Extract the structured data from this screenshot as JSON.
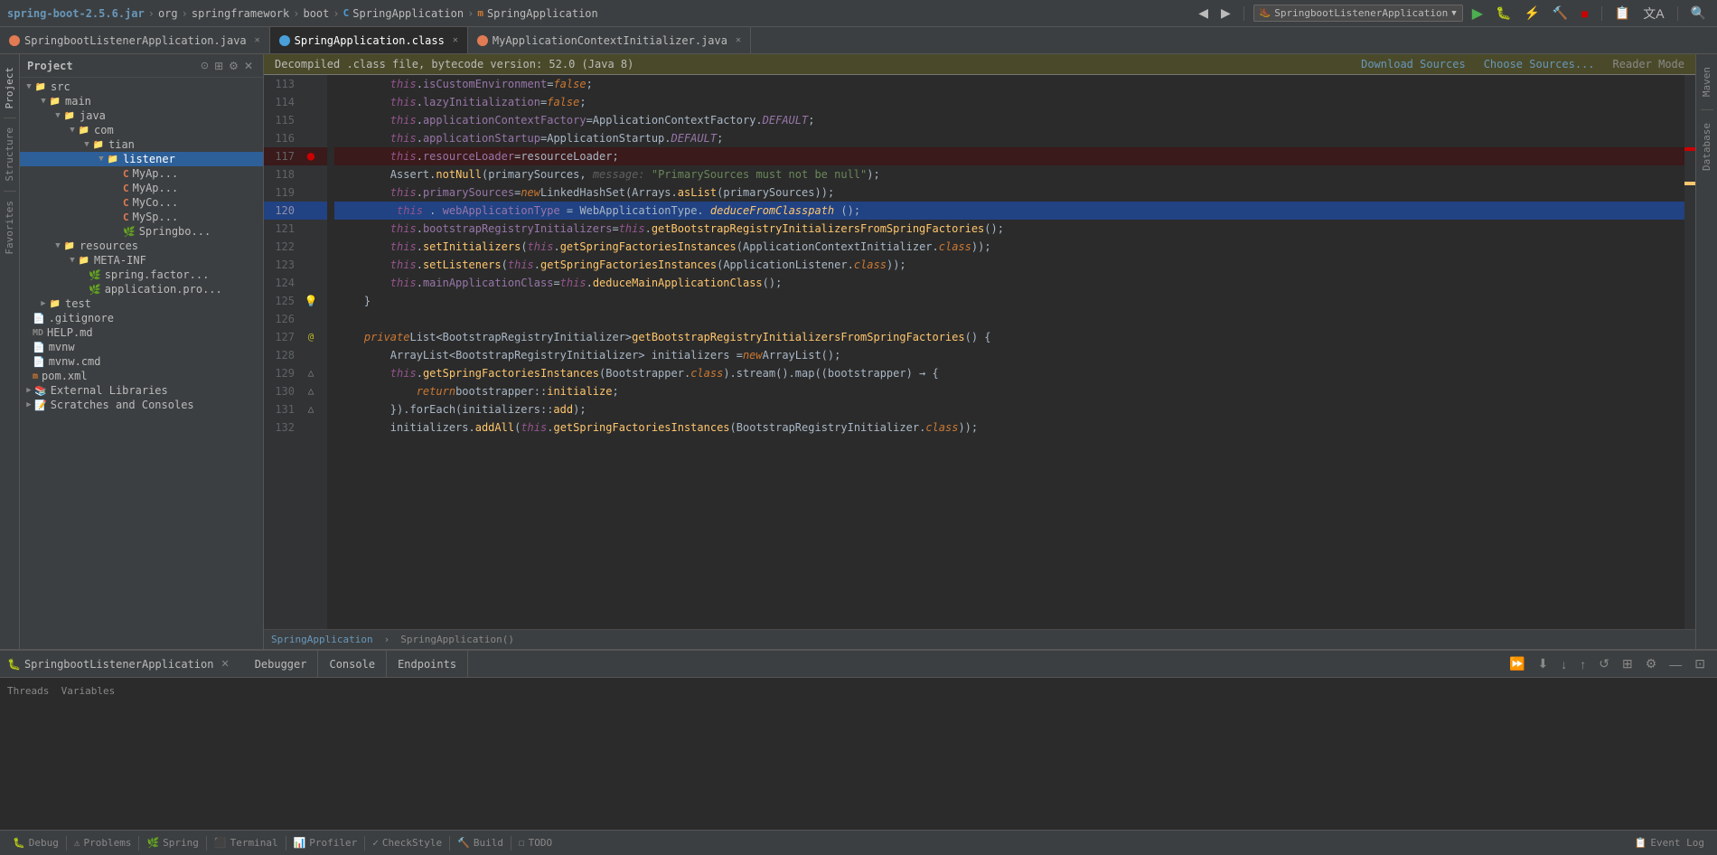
{
  "topbar": {
    "breadcrumb": [
      {
        "label": "spring-boot-2.5.6.jar",
        "type": "jar"
      },
      {
        "label": "org",
        "type": "package"
      },
      {
        "label": "springframework",
        "type": "package"
      },
      {
        "label": "boot",
        "type": "package"
      },
      {
        "label": "SpringApplication",
        "type": "class",
        "icon": "C"
      },
      {
        "label": "SpringApplication",
        "type": "method",
        "icon": "m"
      }
    ],
    "runConfig": "SpringbootListenerApplication",
    "buttons": [
      "←",
      "→",
      "⚙",
      "▶",
      "🐛",
      "⚡",
      "⟳",
      "■",
      "📋",
      "A",
      "□",
      "🔍"
    ]
  },
  "tabs": [
    {
      "label": "SpringbootListenerApplication.java",
      "type": "java",
      "active": false,
      "closeable": true
    },
    {
      "label": "SpringApplication.class",
      "type": "class",
      "active": true,
      "closeable": true
    },
    {
      "label": "MyApplicationContextInitializer.java",
      "type": "java",
      "active": false,
      "closeable": true
    }
  ],
  "banner": {
    "text": "Decompiled .class file, bytecode version: 52.0 (Java 8)",
    "downloadSources": "Download Sources",
    "chooseSources": "Choose Sources...",
    "readerMode": "Reader Mode"
  },
  "fileTree": {
    "title": "Project",
    "items": [
      {
        "indent": 0,
        "type": "folder",
        "label": "src",
        "expanded": true
      },
      {
        "indent": 1,
        "type": "folder",
        "label": "main",
        "expanded": true
      },
      {
        "indent": 2,
        "type": "folder",
        "label": "java",
        "expanded": true
      },
      {
        "indent": 3,
        "type": "folder",
        "label": "com",
        "expanded": true
      },
      {
        "indent": 4,
        "type": "folder",
        "label": "tian",
        "expanded": true
      },
      {
        "indent": 5,
        "type": "folder",
        "label": "listener",
        "expanded": true,
        "selected": true
      },
      {
        "indent": 6,
        "type": "class-c",
        "label": "MyAp..."
      },
      {
        "indent": 6,
        "type": "class-c",
        "label": "MyAp..."
      },
      {
        "indent": 6,
        "type": "class-c",
        "label": "MyCo..."
      },
      {
        "indent": 6,
        "type": "class-c",
        "label": "MySp..."
      },
      {
        "indent": 6,
        "type": "springboot",
        "label": "Springbo..."
      },
      {
        "indent": 2,
        "type": "folder",
        "label": "resources",
        "expanded": true
      },
      {
        "indent": 3,
        "type": "folder",
        "label": "META-INF",
        "expanded": true
      },
      {
        "indent": 4,
        "type": "spring",
        "label": "spring.factor..."
      },
      {
        "indent": 4,
        "type": "props",
        "label": "application.pro..."
      },
      {
        "indent": 1,
        "type": "folder",
        "label": "test",
        "collapsed": true
      },
      {
        "indent": 0,
        "type": "file-git",
        "label": ".gitignore"
      },
      {
        "indent": 0,
        "type": "file-md",
        "label": "HELP.md"
      },
      {
        "indent": 0,
        "type": "file",
        "label": "mvnw"
      },
      {
        "indent": 0,
        "type": "file",
        "label": "mvnw.cmd"
      },
      {
        "indent": 0,
        "type": "file-xml",
        "label": "pom.xml"
      },
      {
        "indent": 0,
        "type": "folder",
        "label": "External Libraries",
        "collapsed": true
      },
      {
        "indent": 0,
        "type": "folder",
        "label": "Scratches and Consoles",
        "collapsed": true
      }
    ]
  },
  "codeLines": [
    {
      "num": 113,
      "marker": "",
      "text": "        <this>.<isCustomEnvironment> = <false>;",
      "type": "code",
      "highlighted": false,
      "breakpoint": false
    },
    {
      "num": 114,
      "marker": "",
      "text": "        <this>.<lazyInitialization> = <false>;",
      "type": "code",
      "highlighted": false,
      "breakpoint": false
    },
    {
      "num": 115,
      "marker": "",
      "text": "        <this>.<applicationContextFactory> = <ApplicationContextFactory>.<DEFAULT>;",
      "type": "code",
      "highlighted": false,
      "breakpoint": false
    },
    {
      "num": 116,
      "marker": "",
      "text": "        <this>.<applicationStartup> = <ApplicationStartup>.<DEFAULT>;",
      "type": "code",
      "highlighted": false,
      "breakpoint": false
    },
    {
      "num": 117,
      "marker": "breakpoint",
      "text": "        <this>.<resourceLoader> = <resourceLoader>;",
      "type": "code",
      "highlighted": false,
      "breakpoint": true
    },
    {
      "num": 118,
      "marker": "",
      "text": "        Assert.<notNull>(<primarySources>,  message: \"PrimarySources must not be null\");",
      "type": "code",
      "highlighted": false,
      "breakpoint": false
    },
    {
      "num": 119,
      "marker": "",
      "text": "        <this>.<primarySources> = <new> LinkedHashSet(Arrays.<asList>(<primarySources>));",
      "type": "code",
      "highlighted": false,
      "breakpoint": false
    },
    {
      "num": 120,
      "marker": "",
      "text": "        <this>.<webApplicationType> = WebApplicationType.<deduceFromClasspath>();",
      "type": "code",
      "highlighted": true,
      "breakpoint": false
    },
    {
      "num": 121,
      "marker": "",
      "text": "        <this>.<bootstrapRegistryInitializers> = <this>.<getBootstrapRegistryInitializersFromSpringFactories>();",
      "type": "code",
      "highlighted": false,
      "breakpoint": false
    },
    {
      "num": 122,
      "marker": "",
      "text": "        <this>.<setInitializers>(<this>.<getSpringFactoriesInstances>(ApplicationContextInitializer.<class>));",
      "type": "code",
      "highlighted": false,
      "breakpoint": false
    },
    {
      "num": 123,
      "marker": "",
      "text": "        <this>.<setListeners>(<this>.<getSpringFactoriesInstances>(ApplicationListener.<class>));",
      "type": "code",
      "highlighted": false,
      "breakpoint": false
    },
    {
      "num": 124,
      "marker": "",
      "text": "        <this>.<mainApplicationClass> = <this>.<deduceMainApplicationClass>();",
      "type": "code",
      "highlighted": false,
      "breakpoint": false
    },
    {
      "num": 125,
      "marker": "bookmark",
      "text": "    }",
      "type": "code",
      "highlighted": false,
      "breakpoint": false
    },
    {
      "num": 126,
      "marker": "",
      "text": "",
      "type": "code",
      "highlighted": false,
      "breakpoint": false
    },
    {
      "num": 127,
      "marker": "annotation",
      "text": "    <private> List<BootstrapRegistryInitializer> <getBootstrapRegistryInitializersFromSpringFactories>() {",
      "type": "code",
      "highlighted": false,
      "breakpoint": false
    },
    {
      "num": 128,
      "marker": "",
      "text": "        ArrayList<BootstrapRegistryInitializer> initializers = <new> ArrayList();",
      "type": "code",
      "highlighted": false,
      "breakpoint": false
    },
    {
      "num": 129,
      "marker": "impl",
      "text": "        <this>.<getSpringFactoriesInstances>(Bootstrapper.<class>).stream().map((bootstrapper) → {",
      "type": "code",
      "highlighted": false,
      "breakpoint": false
    },
    {
      "num": 130,
      "marker": "impl",
      "text": "            <return> bootstrapper::<initialize>;",
      "type": "code",
      "highlighted": false,
      "breakpoint": false
    },
    {
      "num": 131,
      "marker": "impl",
      "text": "        }).forEach(initializers::<add>);",
      "type": "code",
      "highlighted": false,
      "breakpoint": false
    },
    {
      "num": 132,
      "marker": "",
      "text": "        initializers.<addAll>(<this>.<getSpringFactoriesInstances>(BootstrapRegistryInitializer.<class>));",
      "type": "code",
      "highlighted": false,
      "breakpoint": false
    }
  ],
  "editorStatus": {
    "breadcrumb": "SpringApplication › SpringApplication()"
  },
  "debugPanel": {
    "appName": "SpringbootListenerApplication",
    "tabs": [
      {
        "label": "Debugger",
        "active": false
      },
      {
        "label": "Console",
        "active": false
      },
      {
        "label": "Endpoints",
        "active": false
      }
    ]
  },
  "statusBar": {
    "items": [
      {
        "label": "Debug",
        "icon": "🐛"
      },
      {
        "label": "Problems",
        "icon": "⚠"
      },
      {
        "label": "Spring",
        "icon": "🌿"
      },
      {
        "label": "Terminal",
        "icon": "⬛"
      },
      {
        "label": "Profiler",
        "icon": "📊"
      },
      {
        "label": "CheckStyle",
        "icon": "✓"
      },
      {
        "label": "Build",
        "icon": "🔨"
      },
      {
        "label": "TODO",
        "icon": "☐"
      },
      {
        "label": "Event Log",
        "icon": "📋"
      }
    ]
  },
  "rightPanels": [
    "Maven",
    "Database"
  ],
  "leftPanels": [
    "Structure",
    "Favorites"
  ]
}
